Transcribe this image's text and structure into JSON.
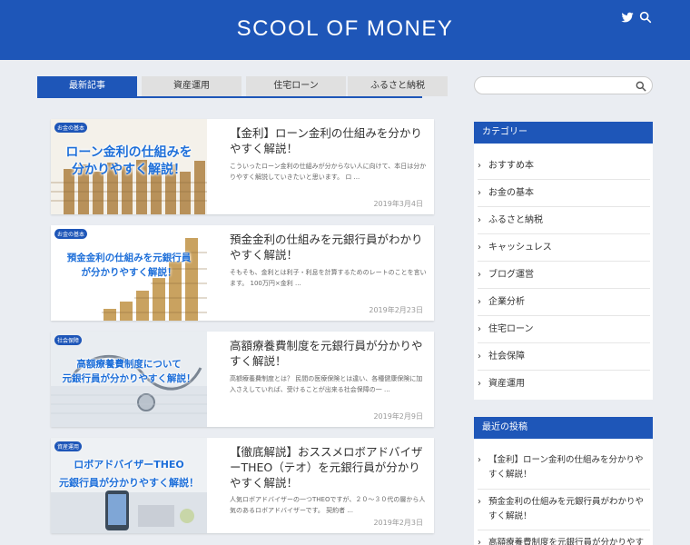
{
  "site": {
    "title": "SCOOL OF MONEY"
  },
  "colors": {
    "brand": "#1e56b8",
    "background": "#eaedf2"
  },
  "header_icons": [
    "twitter-icon",
    "search-icon"
  ],
  "tabs": [
    {
      "label": "最新記事",
      "active": true
    },
    {
      "label": "資産運用",
      "active": false
    },
    {
      "label": "住宅ローン",
      "active": false
    },
    {
      "label": "ふるさと納税",
      "active": false
    }
  ],
  "search": {
    "placeholder": ""
  },
  "posts": [
    {
      "category": "お金の基本",
      "thumb_text": [
        "ローン金利の仕組みを",
        "分かりやすく解説！"
      ],
      "title": "【金利】ローン金利の仕組みを分かりやすく解説！",
      "excerpt": "こういったローン金利の仕組みが分からない人に向けて、本日は分かりやすく解説していきたいと思います。 ロ ...",
      "date": "2019年3月4日"
    },
    {
      "category": "お金の基本",
      "thumb_text": [
        "預金金利の仕組みを元銀行員",
        "が分かりやすく解説！"
      ],
      "title": "預金金利の仕組みを元銀行員がわかりやすく解説！",
      "excerpt": "そもそも、金利とは利子・利息を計算するためのレートのことを言います。 100万円×金利 ...",
      "date": "2019年2月23日"
    },
    {
      "category": "社会保障",
      "thumb_text": [
        "高額療養費制度について",
        "元銀行員が分かりやすく解説！"
      ],
      "title": "高額療養費制度を元銀行員が分かりやすく解説！",
      "excerpt": "高額療養費制度とは？ 民間の医療保険とは違い、各種健康保険に加入さえしていれば、受けることが出来る社会保障の一 ...",
      "date": "2019年2月9日"
    },
    {
      "category": "資産運用",
      "thumb_text": [
        "ロボアドバイザーTHEO",
        "元銀行員が分かりやすく解説！"
      ],
      "title": "【徹底解説】おススメロボアドバイザーTHEO（テオ）を元銀行員が分かりやすく解説！",
      "excerpt": "人気ロボアドバイザーの一つTHEOですが、２０～３０代の層から人気のあるロボアドバイザーです。 契約者 ...",
      "date": "2019年2月3日"
    }
  ],
  "sidebar": {
    "categories_title": "カテゴリー",
    "categories": [
      "おすすめ本",
      "お金の基本",
      "ふるさと納税",
      "キャッシュレス",
      "ブログ運営",
      "企業分析",
      "住宅ローン",
      "社会保障",
      "資産運用"
    ],
    "recent_title": "最近の投稿",
    "recent": [
      "【金利】ローン金利の仕組みを分かりやすく解説！",
      "預金金利の仕組みを元銀行員がわかりやすく解説！",
      "高額療養費制度を元銀行員が分かりやすく解説！"
    ]
  }
}
